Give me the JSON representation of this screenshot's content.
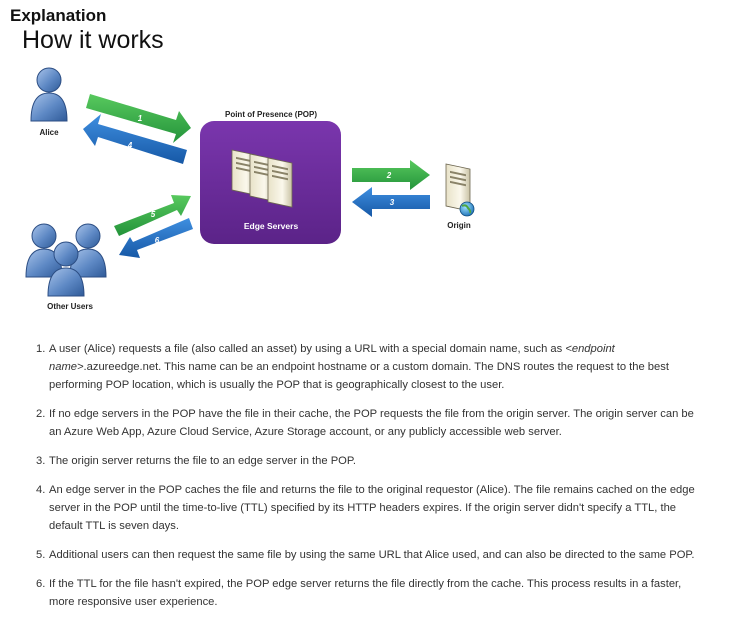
{
  "header": {
    "section_title": "Explanation",
    "heading": "How it works"
  },
  "diagram": {
    "pop_label": "Point of Presence (POP)",
    "edge_servers_label": "Edge Servers",
    "origin_label": "Origin",
    "alice_label": "Alice",
    "other_users_label": "Other Users",
    "arrow_labels": [
      "1",
      "2",
      "3",
      "4",
      "5",
      "6"
    ],
    "colors": {
      "request_arrow": "#3cb44b",
      "response_arrow": "#1f73c6",
      "pop_box": "#6a2c9c",
      "user_icon": "#5d88c4"
    },
    "icons": [
      "user-icon",
      "user-group-icon",
      "server-stack-icon",
      "origin-server-icon"
    ]
  },
  "steps": [
    {
      "number": "1.",
      "pre": "A user (Alice) requests a file (also called an asset) by using a URL with a special domain name, such as ",
      "em": "<endpoint name>",
      "post": ".azureedge.net. This name can be an endpoint hostname or a custom domain. The DNS routes the request to the best performing POP location, which is usually the POP that is geographically closest to the user."
    },
    {
      "number": "2.",
      "pre": "If no edge servers in the POP have the file in their cache, the POP requests the file from the origin server. The origin server can be an Azure Web App, Azure Cloud Service, Azure Storage account, or any publicly accessible web server.",
      "em": "",
      "post": ""
    },
    {
      "number": "3.",
      "pre": "The origin server returns the file to an edge server in the POP.",
      "em": "",
      "post": ""
    },
    {
      "number": "4.",
      "pre": "An edge server in the POP caches the file and returns the file to the original requestor (Alice). The file remains cached on the edge server in the POP until the time-to-live (TTL) specified by its HTTP headers expires. If the origin server didn't specify a TTL, the default TTL is seven days.",
      "em": "",
      "post": ""
    },
    {
      "number": "5.",
      "pre": "Additional users can then request the same file by using the same URL that Alice used, and can also be directed to the same POP.",
      "em": "",
      "post": ""
    },
    {
      "number": "6.",
      "pre": "If the TTL for the file hasn't expired, the POP edge server returns the file directly from the cache. This process results in a faster, more responsive user experience.",
      "em": "",
      "post": ""
    }
  ]
}
